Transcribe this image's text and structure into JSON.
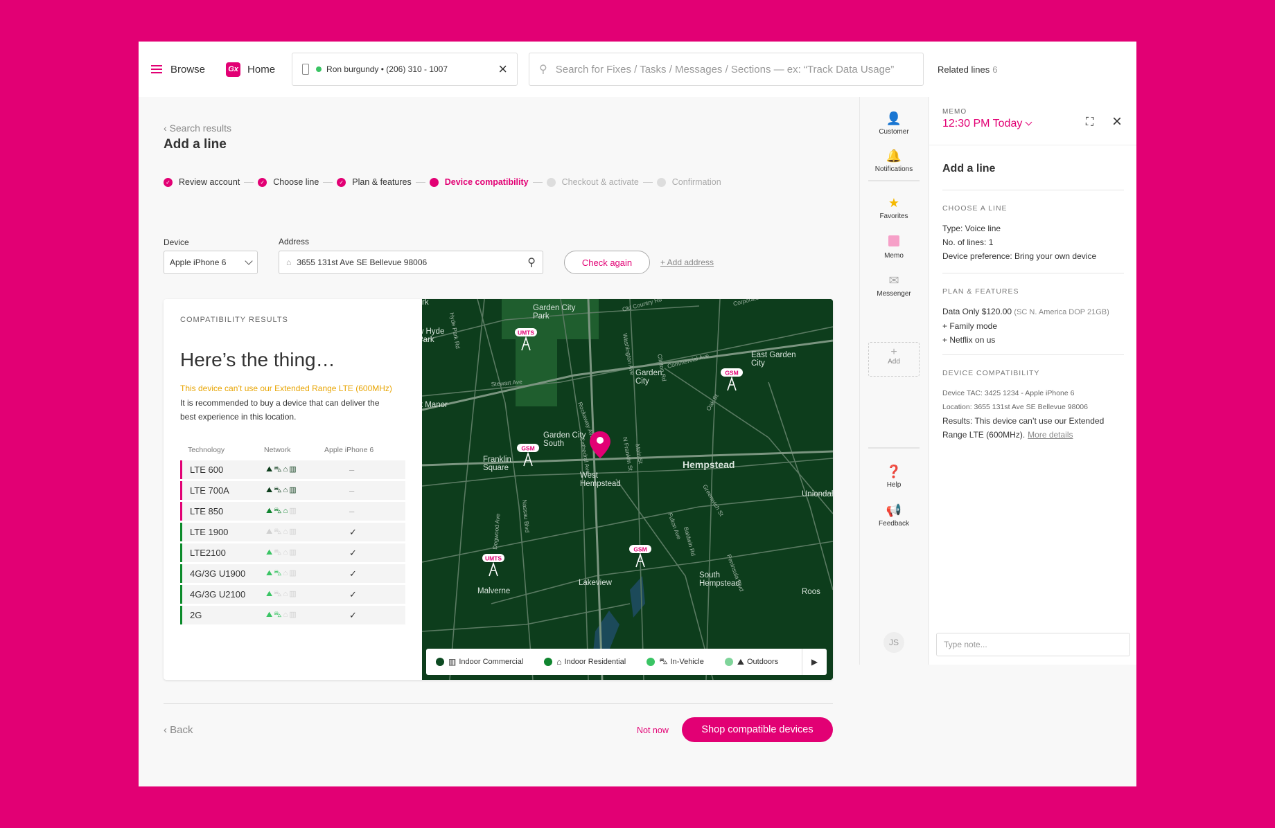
{
  "topbar": {
    "browse": "Browse",
    "logo": "Gx",
    "home": "Home",
    "customer": "Ron burgundy • (206) 310 - 1007",
    "search_placeholder": "Search for Fixes / Tasks / Messages / Sections — ex: “Track Data Usage”",
    "related_label": "Related lines",
    "related_count": "6"
  },
  "breadcrumb": "Search results",
  "page_title": "Add a line",
  "steps": [
    {
      "label": "Review account",
      "state": "done"
    },
    {
      "label": "Choose line",
      "state": "done"
    },
    {
      "label": "Plan & features",
      "state": "done"
    },
    {
      "label": "Device compatibility",
      "state": "current"
    },
    {
      "label": "Checkout & activate",
      "state": "todo"
    },
    {
      "label": "Confirmation",
      "state": "todo"
    }
  ],
  "form": {
    "device_label": "Device",
    "device_value": "Apple iPhone 6",
    "address_label": "Address",
    "address_value": "3655 131st Ave SE Bellevue 98006",
    "check_again": "Check again",
    "add_address": "+ Add address"
  },
  "results": {
    "caption": "COMPATIBILITY RESULTS",
    "heading": "Here’s the thing…",
    "warning": "This device can’t use our Extended Range LTE (600MHz)",
    "body": "It is recommended to buy a device that can deliver the best experience in this location.",
    "col_tech": "Technology",
    "col_network": "Network",
    "col_device": "Apple iPhone 6",
    "rows": [
      {
        "tech": "LTE 600",
        "network": [
          3,
          3,
          3,
          3
        ],
        "compatible": false
      },
      {
        "tech": "LTE 700A",
        "network": [
          3,
          3,
          3,
          3
        ],
        "compatible": false
      },
      {
        "tech": "LTE 850",
        "network": [
          2,
          2,
          2,
          0
        ],
        "compatible": false
      },
      {
        "tech": "LTE 1900",
        "network": [
          0,
          0,
          0,
          0
        ],
        "compatible": true
      },
      {
        "tech": "LTE2100",
        "network": [
          1,
          0,
          0,
          0
        ],
        "compatible": true
      },
      {
        "tech": "4G/3G U1900",
        "network": [
          1,
          1,
          0,
          0
        ],
        "compatible": true
      },
      {
        "tech": "4G/3G U2100",
        "network": [
          1,
          0,
          0,
          0
        ],
        "compatible": true
      },
      {
        "tech": "2G",
        "network": [
          1,
          1,
          0,
          0
        ],
        "compatible": true
      }
    ],
    "dash": "–",
    "check": "✓"
  },
  "map": {
    "places": [
      {
        "name": "Garden City Park"
      },
      {
        "name": "East Garden City"
      },
      {
        "name": "Garden City"
      },
      {
        "name": "Garden City South"
      },
      {
        "name": "Franklin Square"
      },
      {
        "name": "West Hempstead"
      },
      {
        "name": "Hempstead"
      },
      {
        "name": "Uniondal"
      },
      {
        "name": "rt Manor"
      },
      {
        "name": "Lakeview"
      },
      {
        "name": "Malverne"
      },
      {
        "name": "South Hempstead"
      },
      {
        "name": "w Hyde Park"
      },
      {
        "name": "Roos"
      },
      {
        "name": "rk"
      }
    ],
    "roads": [
      "Old Country Rd",
      "Stewart Ave",
      "Commercial Ave",
      "Corporate Dr",
      "Clinton Rd",
      "Washington Ave",
      "Nassau Blvd",
      "Peninsula Blvd",
      "N Franklin St",
      "Dogwood Ave",
      "Hyde Park Rd",
      "Rockaway Ave",
      "Cathedral Ave",
      "Main St",
      "Fulton Ave",
      "Greenwich St",
      "Baldwin Rd",
      "Oak St"
    ],
    "towers": [
      "UMTS",
      "GSM",
      "GSM",
      "UMTS",
      "GSM"
    ],
    "legend": [
      {
        "label": "Indoor Commercial",
        "color": "#0d4a22"
      },
      {
        "label": "Indoor Residential",
        "color": "#10852f"
      },
      {
        "label": "In-Vehicle",
        "color": "#3ac464"
      },
      {
        "label": "Outdoors",
        "color": "#7fd49a"
      }
    ]
  },
  "footer": {
    "back": "Back",
    "not_now": "Not now",
    "shop": "Shop compatible devices"
  },
  "rail": {
    "items": [
      "Customer",
      "Notifications",
      "Favorites",
      "Memo",
      "Messenger"
    ],
    "add": "Add",
    "help": "Help",
    "feedback": "Feedback",
    "initials": "JS"
  },
  "memo": {
    "caption": "MEMO",
    "time": "12:30 PM Today",
    "title": "Add a line",
    "choose_line_caption": "CHOOSE A LINE",
    "type": "Type: Voice line",
    "lines": "No. of lines: 1",
    "device_pref": "Device preference: Bring your own device",
    "plan_caption": "PLAN & FEATURES",
    "plan": "Data Only $120.00",
    "plan_detail": "(SC N. America DOP 21GB)",
    "family": "+ Family mode",
    "netflix": "+ Netflix on us",
    "compat_caption": "DEVICE COMPATIBILITY",
    "tac": "Device TAC: 3425 1234 - Apple iPhone 6",
    "location": "Location: 3655 131st Ave SE Bellevue 98006",
    "results": "Results: This device can’t use our Extended Range LTE (600MHz).",
    "more": "More details",
    "note_placeholder": "Type note..."
  },
  "colors": {
    "brand": "#e20074",
    "map_bg": "#0d3d1c",
    "warning": "#e8a400",
    "incompatible_bar": "#e20074",
    "compatible_bar": "#0b8a2a"
  }
}
